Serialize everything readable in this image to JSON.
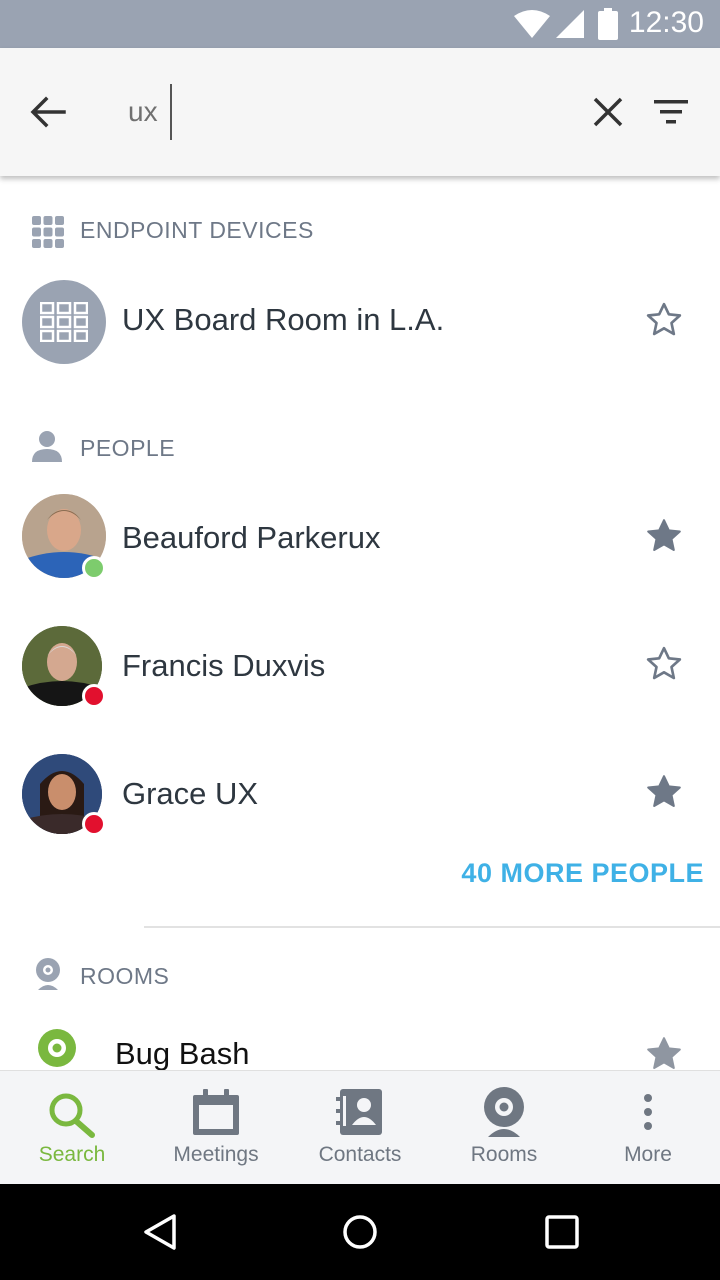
{
  "status_bar": {
    "time": "12:30"
  },
  "search": {
    "query": "ux"
  },
  "sections": {
    "endpoint": {
      "title": "ENDPOINT DEVICES",
      "items": [
        {
          "name": "UX Board Room in L.A.",
          "starred": false
        }
      ]
    },
    "people": {
      "title": "PEOPLE",
      "items": [
        {
          "name": "Beauford Parkerux",
          "status": "online",
          "starred": true
        },
        {
          "name": "Francis Duxvis",
          "status": "busy",
          "starred": false
        },
        {
          "name": "Grace UX",
          "status": "busy",
          "starred": true
        }
      ],
      "more_label": "40 MORE PEOPLE"
    },
    "rooms": {
      "title": "ROOMS",
      "items": [
        {
          "name": "Bug Bash",
          "starred": true
        }
      ]
    }
  },
  "bottom_nav": {
    "items": [
      {
        "label": "Search",
        "icon": "search-icon",
        "active": true
      },
      {
        "label": "Meetings",
        "icon": "calendar-icon",
        "active": false
      },
      {
        "label": "Contacts",
        "icon": "contacts-book-icon",
        "active": false
      },
      {
        "label": "Rooms",
        "icon": "webcam-icon",
        "active": false
      },
      {
        "label": "More",
        "icon": "more-vertical-icon",
        "active": false
      }
    ]
  },
  "colors": {
    "status_bar": "#9aa3b2",
    "accent_green": "#7ab83f",
    "link_blue": "#3fb1e6",
    "presence_online": "#7dcc6d",
    "presence_busy": "#e2102e",
    "icon_gray": "#6e7887"
  }
}
